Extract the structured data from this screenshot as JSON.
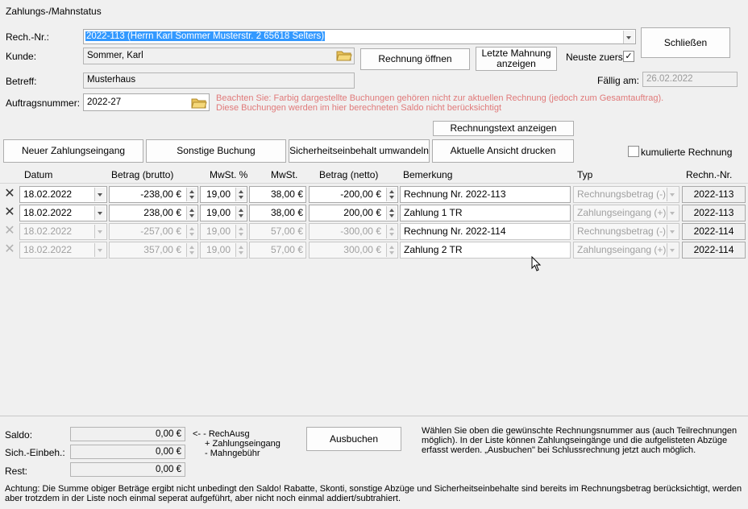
{
  "window": {
    "title": "Zahlungs-/Mahnstatus"
  },
  "header": {
    "rech_nr_label": "Rech.-Nr.:",
    "rech_nr_value": "2022-113 (Herrn Karl Sommer Musterstr. 2 65618 Selters)",
    "kunde_label": "Kunde:",
    "kunde_value": "Sommer, Karl",
    "betreff_label": "Betreff:",
    "betreff_value": "Musterhaus",
    "auftrag_label": "Auftragsnummer:",
    "auftrag_value": "2022-27",
    "hint_line1": "Beachten Sie: Farbig dargestellte Buchungen gehören nicht zur aktuellen Rechnung (jedoch zum Gesamtauftrag).",
    "hint_line2": "Diese Buchungen werden im hier berechneten Saldo nicht berücksichtigt",
    "faellig_label": "Fällig am:",
    "faellig_value": "26.02.2022",
    "neuste_label": "Neuste zuerst",
    "neuste_checked": true
  },
  "buttons": {
    "schliessen": "Schließen",
    "rechnung_oeffnen": "Rechnung öffnen",
    "letzte_mahnung_1": "Letzte Mahnung",
    "letzte_mahnung_2": "anzeigen",
    "rechnungstext": "Rechnungstext anzeigen",
    "neuer_zahlungseingang": "Neuer Zahlungseingang",
    "sonstige_buchung": "Sonstige Buchung",
    "sicherheitseinbehalt": "Sicherheitseinbehalt umwandeln",
    "ansicht_drucken": "Aktuelle Ansicht drucken",
    "kumulierte_label": "kumulierte Rechnung",
    "ausbuchen": "Ausbuchen"
  },
  "table": {
    "columns": [
      "Datum",
      "Betrag (brutto)",
      "MwSt. %",
      "MwSt.",
      "Betrag (netto)",
      "Bemerkung",
      "Typ",
      "Rechn.-Nr."
    ],
    "rows": [
      {
        "datum": "18.02.2022",
        "brutto": "-238,00 €",
        "mwst_pct": "19,00",
        "mwst": "38,00 €",
        "netto": "-200,00 €",
        "bemerkung": "Rechnung Nr. 2022-113",
        "typ": "Rechnungsbetrag (-)",
        "rechn_nr": "2022-113",
        "active": true
      },
      {
        "datum": "18.02.2022",
        "brutto": "238,00 €",
        "mwst_pct": "19,00",
        "mwst": "38,00 €",
        "netto": "200,00 €",
        "bemerkung": "Zahlung 1 TR",
        "typ": "Zahlungseingang (+)",
        "rechn_nr": "2022-113",
        "active": true
      },
      {
        "datum": "18.02.2022",
        "brutto": "-257,00 €",
        "mwst_pct": "19,00",
        "mwst": "57,00 €",
        "netto": "-300,00 €",
        "bemerkung": "Rechnung Nr. 2022-114",
        "typ": "Rechnungsbetrag (-)",
        "rechn_nr": "2022-114",
        "active": false
      },
      {
        "datum": "18.02.2022",
        "brutto": "357,00 €",
        "mwst_pct": "19,00",
        "mwst": "57,00 €",
        "netto": "300,00 €",
        "bemerkung": "Zahlung 2 TR",
        "typ": "Zahlungseingang (+)",
        "rechn_nr": "2022-114",
        "active": false
      }
    ]
  },
  "summary": {
    "saldo_label": "Saldo:",
    "saldo_value": "0,00 €",
    "sich_label": "Sich.-Einbeh.:",
    "sich_value": "0,00 €",
    "rest_label": "Rest:",
    "rest_value": "0,00 €",
    "legend_1": "<- - RechAusg",
    "legend_2": "+ Zahlungseingang",
    "legend_3": "- Mahngebühr",
    "help_text": "Wählen Sie oben die gewünschte Rechnungsnummer aus (auch Teilrechnungen möglich). In der Liste können Zahlungseingänge und die aufgelisteten Abzüge erfasst werden. „Ausbuchen\" bei Schlussrechnung jetzt auch möglich.",
    "footer_note": "Achtung: Die Summe obiger Beträge ergibt nicht unbedingt den Saldo! Rabatte, Skonti, sonstige Abzüge und Sicherheitseinbehalte sind bereits im Rechnungsbetrag berücksichtigt, werden aber trotzdem in der Liste noch einmal seperat aufgeführt, aber nicht noch einmal addiert/subtrahiert."
  },
  "colors": {
    "selection": "#3399ff",
    "hint": "#e07a7a",
    "disabled_text": "#a0a0a0"
  }
}
